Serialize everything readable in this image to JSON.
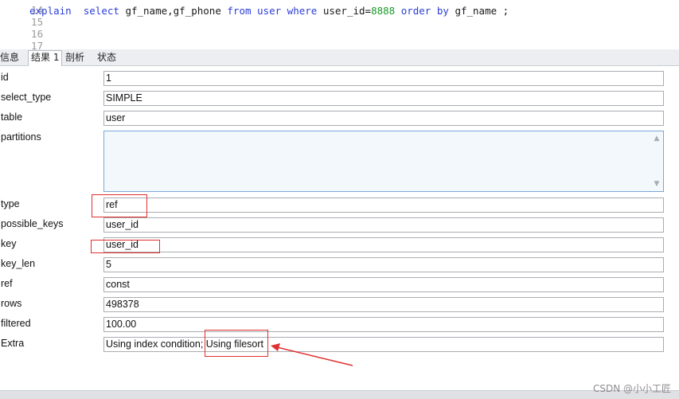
{
  "editor": {
    "lines": [
      {
        "num": "14",
        "text": ""
      },
      {
        "num": "15",
        "text": ""
      },
      {
        "num": "16",
        "text": ""
      },
      {
        "num": "17",
        "text": ""
      }
    ],
    "query": {
      "explain": "explain",
      "select": "select",
      "columns": "gf_name,gf_phone",
      "from": "from",
      "table": "user",
      "where": "where",
      "condition": "user_id=",
      "value": "8888",
      "order_by": "order by",
      "order_col": "gf_name ;"
    }
  },
  "tabs": [
    {
      "label": "信息",
      "active": false
    },
    {
      "label": "结果 1",
      "active": true
    },
    {
      "label": "剖析",
      "active": false
    },
    {
      "label": "状态",
      "active": false
    }
  ],
  "fields": {
    "id": {
      "label": "id",
      "value": "1"
    },
    "select_type": {
      "label": "select_type",
      "value": "SIMPLE"
    },
    "table": {
      "label": "table",
      "value": "user"
    },
    "partitions": {
      "label": "partitions",
      "value": ""
    },
    "type": {
      "label": "type",
      "value": "ref"
    },
    "possible_keys": {
      "label": "possible_keys",
      "value": "user_id"
    },
    "key": {
      "label": "key",
      "value": "user_id"
    },
    "key_len": {
      "label": "key_len",
      "value": "5"
    },
    "ref": {
      "label": "ref",
      "value": "const"
    },
    "rows": {
      "label": "rows",
      "value": "498378"
    },
    "filtered": {
      "label": "filtered",
      "value": "100.00"
    },
    "extra": {
      "label": "Extra",
      "value": "Using index condition; Using filesort"
    }
  },
  "watermark": "CSDN @小小工匠",
  "colors": {
    "keyword": "#2b3dd6",
    "number": "#1a9a2a",
    "annotation_red": "#e0302f",
    "textarea_border": "#7aa7d8"
  }
}
